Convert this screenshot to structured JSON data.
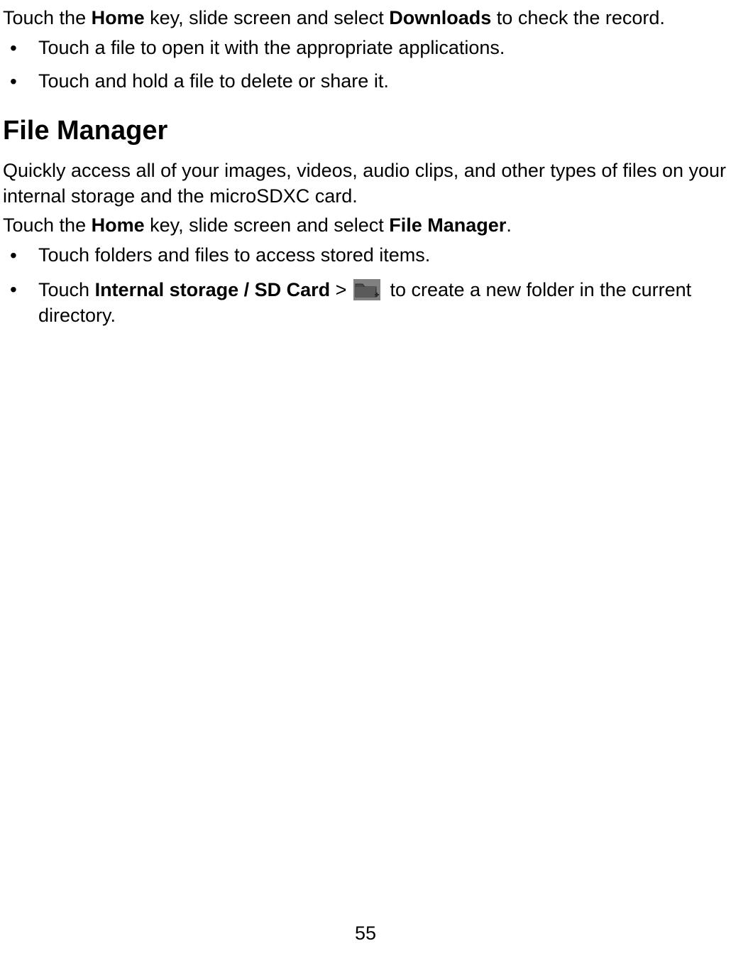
{
  "intro": {
    "part1": "Touch the ",
    "bold1": "Home",
    "part2": " key, slide screen and select ",
    "bold2": "Downloads",
    "part3": " to check the record."
  },
  "introList": [
    "Touch a file to open it with the appropriate applications.",
    "Touch and hold a file to delete or share it."
  ],
  "section": {
    "heading": "File Manager",
    "desc": "Quickly access all of your images, videos, audio clips, and other types of files on your internal storage and the microSDXC card.",
    "step": {
      "part1": "Touch the ",
      "bold1": "Home",
      "part2": " key, slide screen and select ",
      "bold2": "File Manager",
      "part3": "."
    },
    "list": {
      "item1": "Touch folders and files to access stored items.",
      "item2": {
        "part1": "Touch ",
        "bold1": "Internal storage / SD Card",
        "part2": " > ",
        "part3": " to create a new folder in the current directory."
      }
    }
  },
  "pageNumber": "55"
}
